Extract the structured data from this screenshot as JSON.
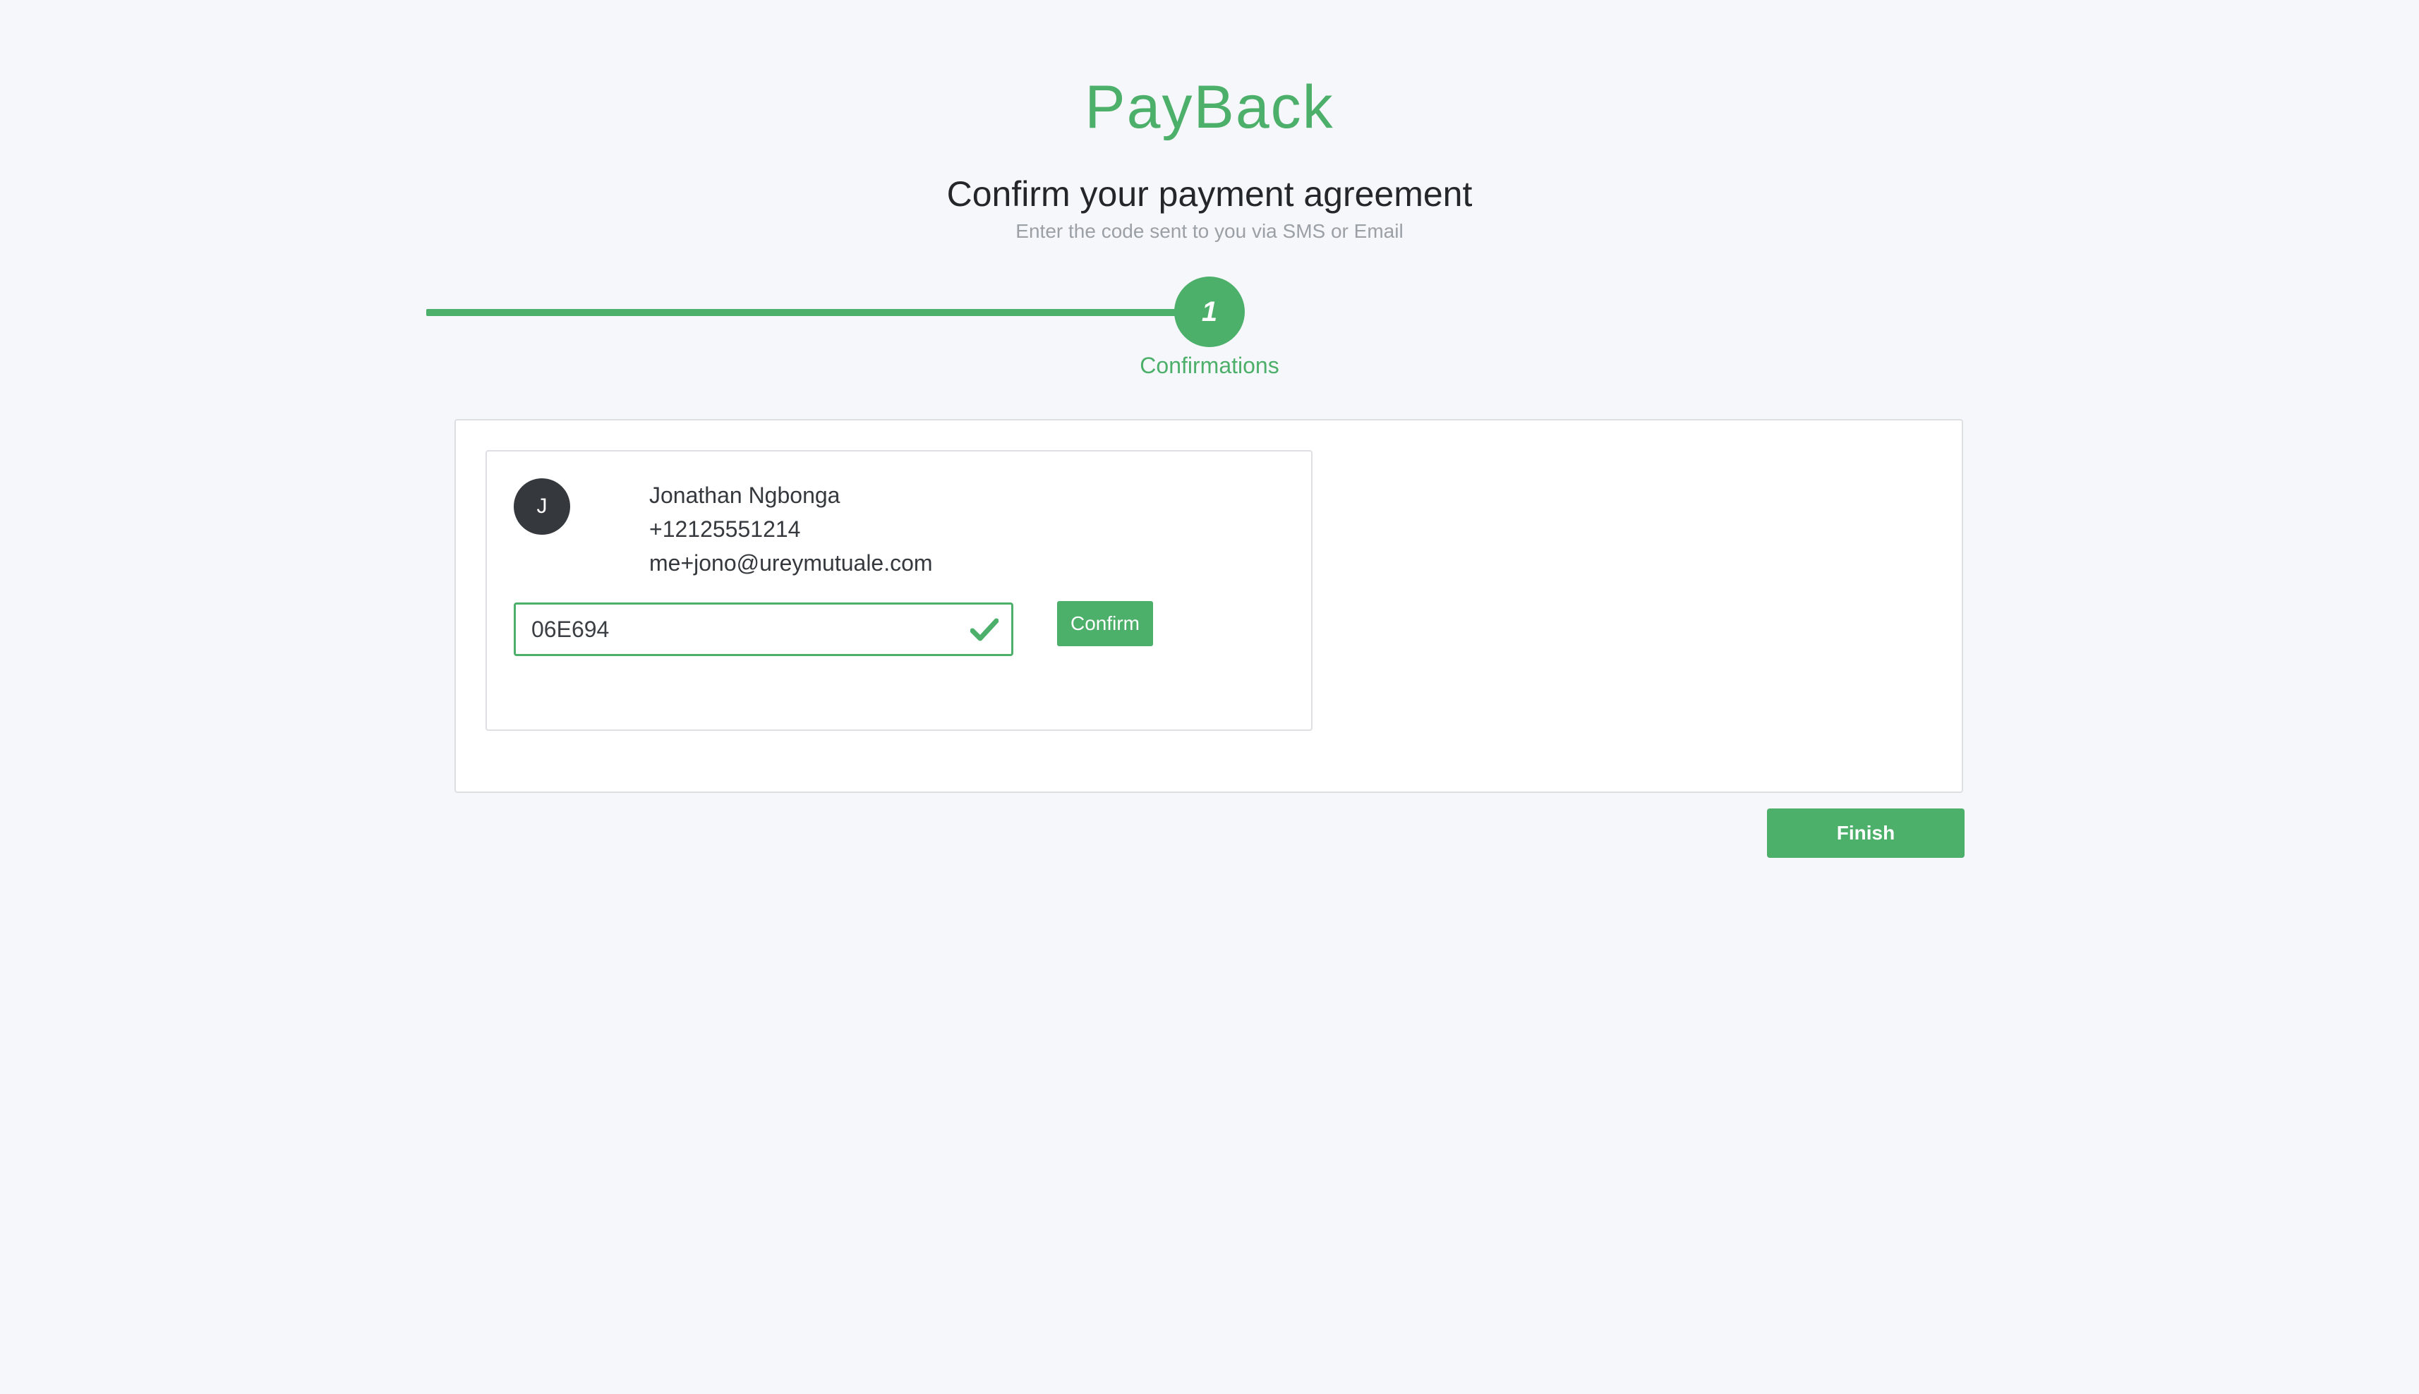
{
  "header": {
    "brand": "PayBack",
    "title": "Confirm your payment agreement",
    "subtitle": "Enter the code sent to you via SMS or Email"
  },
  "stepper": {
    "step_number": "1",
    "step_label": "Confirmations",
    "progress": 1.0
  },
  "signer": {
    "avatar_initial": "J",
    "name": "Jonathan Ngbonga",
    "phone": "+12125551214",
    "email": "me+jono@ureymutuale.com",
    "code_value": "06E694",
    "code_valid_icon": "check-icon",
    "confirm_label": "Confirm"
  },
  "footer": {
    "finish_label": "Finish"
  },
  "colors": {
    "accent": "#4caf6a",
    "background": "#f6f7fa",
    "avatar": "#35393d"
  }
}
